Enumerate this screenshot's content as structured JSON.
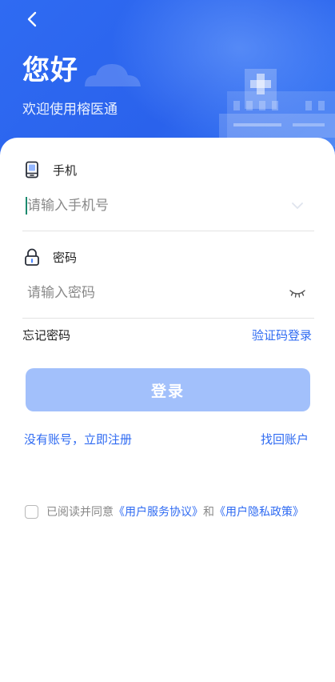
{
  "header": {
    "greeting": "您好",
    "welcome": "欢迎使用榕医通"
  },
  "phone_field": {
    "label": "手机",
    "placeholder": "请输入手机号"
  },
  "password_field": {
    "label": "密码",
    "placeholder": "请输入密码"
  },
  "links": {
    "forgot_password": "忘记密码",
    "code_login": "验证码登录",
    "register": "没有账号，立即注册",
    "recover_account": "找回账户"
  },
  "login_button": "登录",
  "agreement": {
    "prefix": "已阅读并同意",
    "service": "《用户服务协议》",
    "and": "和",
    "privacy": "《用户隐私政策》"
  },
  "colors": {
    "brand_blue": "#2f6bf2",
    "button_disabled": "#a2c0fb",
    "caret": "#1b8a6e"
  }
}
